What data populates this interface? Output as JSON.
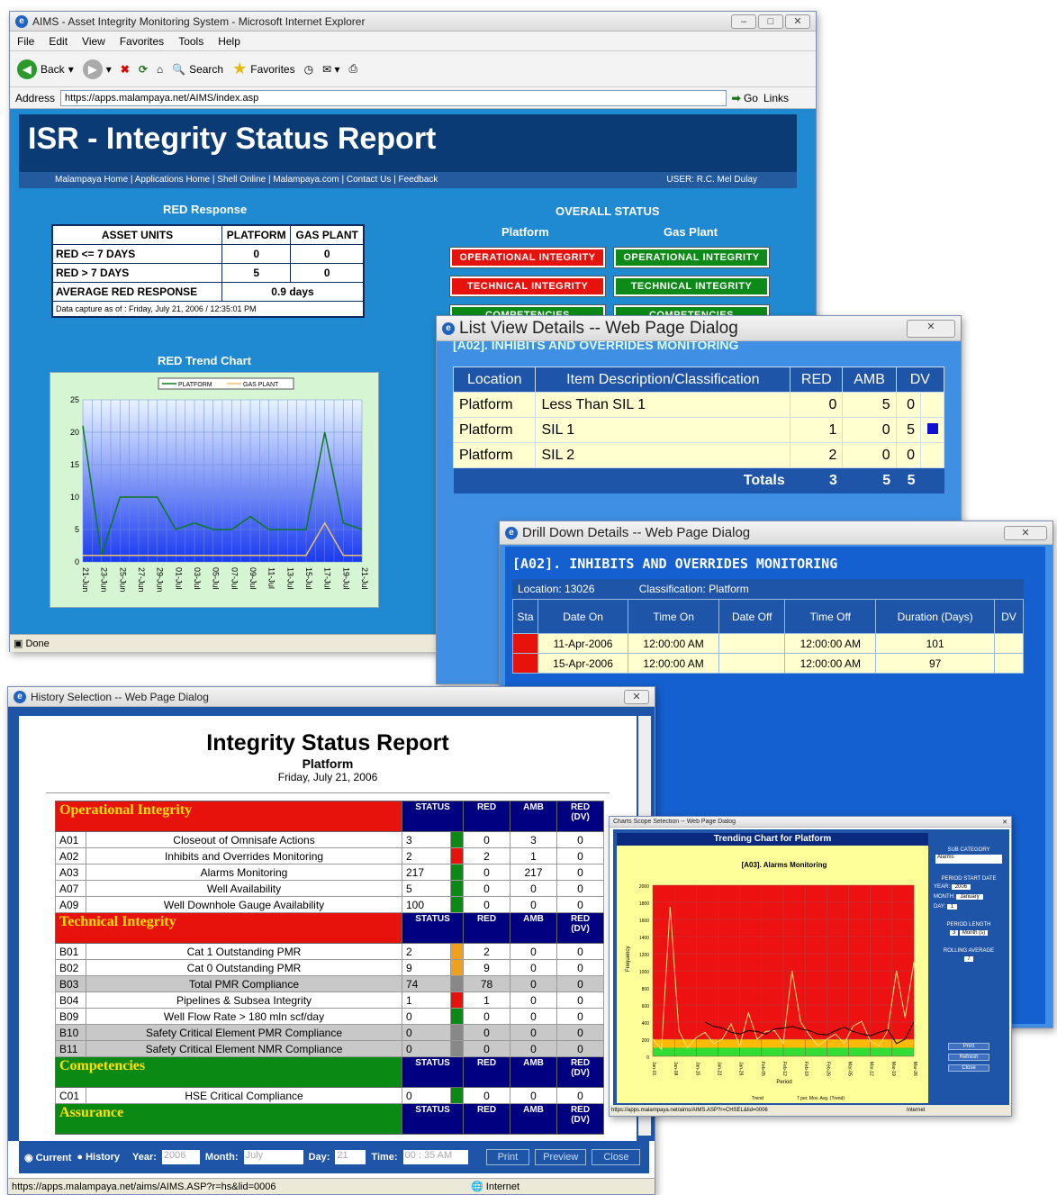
{
  "main": {
    "title": "AIMS - Asset Integrity Monitoring System - Microsoft Internet Explorer",
    "menu": [
      "File",
      "Edit",
      "View",
      "Favorites",
      "Tools",
      "Help"
    ],
    "toolbar": {
      "back": "Back",
      "search": "Search",
      "favorites": "Favorites"
    },
    "address_label": "Address",
    "address": "https://apps.malampaya.net/AIMS/index.asp",
    "go": "Go",
    "links": "Links",
    "banner": "ISR - Integrity Status Report",
    "nav": "Malampaya Home | Applications Home | Shell Online | Malampaya.com | Contact Us | Feedback",
    "user": "USER: R.C. Mel Dulay",
    "red_response_title": "RED Response",
    "red_table": {
      "headers": [
        "ASSET UNITS",
        "PLATFORM",
        "GAS PLANT"
      ],
      "rows": [
        [
          "RED <= 7 DAYS",
          "0",
          "0"
        ],
        [
          "RED > 7 DAYS",
          "5",
          "0"
        ]
      ],
      "avg_label": "AVERAGE RED RESPONSE",
      "avg_value": "0.9 days",
      "capture": "Data capture as of :  Friday, July 21, 2006 / 12:35:01 PM"
    },
    "overall_status": "OVERALL STATUS",
    "col_platform": "Platform",
    "col_gasplant": "Gas Plant",
    "status_pills": [
      [
        "OPERATIONAL INTEGRITY",
        "#e8120c",
        "OPERATIONAL INTEGRITY",
        "#0d8a17"
      ],
      [
        "TECHNICAL INTEGRITY",
        "#e8120c",
        "TECHNICAL INTEGRITY",
        "#0d8a17"
      ],
      [
        "COMPETENCIES",
        "#0d8a17",
        "COMPETENCIES",
        "#0d8a17"
      ]
    ],
    "trend_title": "RED Trend Chart",
    "status": "Done"
  },
  "chart_data": [
    {
      "type": "line",
      "title": "RED Trend Chart",
      "ylim": [
        0,
        25
      ],
      "categories": [
        "21-Jun",
        "23-Jun",
        "25-Jun",
        "27-Jun",
        "29-Jun",
        "01-Jul",
        "03-Jul",
        "05-Jul",
        "07-Jul",
        "09-Jul",
        "11-Jul",
        "13-Jul",
        "15-Jul",
        "17-Jul",
        "19-Jul",
        "21-Jul"
      ],
      "series": [
        {
          "name": "PLATFORM",
          "color": "#0a7a1c",
          "values": [
            21,
            1,
            10,
            10,
            10,
            5,
            6,
            5,
            5,
            7,
            5,
            5,
            5,
            20,
            6,
            5
          ]
        },
        {
          "name": "GAS PLANT",
          "color": "#f0c070",
          "values": [
            1,
            1,
            1,
            1,
            1,
            1,
            1,
            1,
            1,
            1,
            1,
            1,
            1,
            6,
            1,
            1
          ]
        }
      ]
    },
    {
      "type": "line",
      "title": "[A03]. Alarms Monitoring",
      "ylabel": "Frequency",
      "xlabel": "Period",
      "ylim": [
        0,
        2000
      ],
      "categories": [
        "Jan-01",
        "Jan-08",
        "Jan-15",
        "Jan-22",
        "Jan-29",
        "Feb-05",
        "Feb-12",
        "Feb-19",
        "Feb-26",
        "Mar-05",
        "Mar-12",
        "Mar-19",
        "Mar-26"
      ],
      "series": [
        {
          "name": "Trend",
          "color": "#ffe080",
          "values": [
            200,
            80,
            1750,
            300,
            100,
            220,
            280,
            150,
            200,
            380,
            120,
            510,
            200,
            290,
            300,
            150,
            1000,
            400,
            250,
            120,
            200,
            260,
            150,
            350,
            410,
            180,
            120,
            300,
            1000,
            450,
            1100
          ]
        },
        {
          "name": "7 per. Mov. Avg. (Trend)",
          "color": "#000000",
          "values": [
            null,
            null,
            null,
            null,
            null,
            null,
            400,
            350,
            330,
            280,
            260,
            300,
            290,
            260,
            320,
            330,
            350,
            320,
            300,
            260,
            250,
            300,
            340,
            290,
            260,
            240,
            280,
            310,
            150,
            200,
            400
          ]
        }
      ]
    }
  ],
  "listview": {
    "title": "List View Details -- Web Page Dialog",
    "heading": "[A02]. INHIBITS AND OVERRIDES MONITORING",
    "headers": [
      "Location",
      "Item Description/Classification",
      "RED",
      "AMB",
      "DV"
    ],
    "rows": [
      [
        "Platform",
        "Less Than SIL 1",
        "0",
        "5",
        "0"
      ],
      [
        "Platform",
        "SIL 1",
        "1",
        "0",
        "5"
      ],
      [
        "Platform",
        "SIL 2",
        "2",
        "0",
        "0"
      ]
    ],
    "totals_label": "Totals",
    "totals": [
      "3",
      "5",
      "5"
    ]
  },
  "drill": {
    "title": "Drill Down Details -- Web Page Dialog",
    "heading": "[A02]. INHIBITS AND OVERRIDES MONITORING",
    "location": "Location: 13026",
    "classification": "Classification: Platform",
    "headers": [
      "Sta",
      "Date On",
      "Time On",
      "Date Off",
      "Time Off",
      "Duration (Days)",
      "DV"
    ],
    "rows": [
      [
        "11-Apr-2006",
        "12:00:00 AM",
        "",
        "12:00:00 AM",
        "101"
      ],
      [
        "15-Apr-2006",
        "12:00:00 AM",
        "",
        "12:00:00 AM",
        "97"
      ]
    ]
  },
  "history": {
    "title": "History Selection -- Web Page Dialog",
    "report_title": "Integrity Status Report",
    "sub": "Platform",
    "date": "Friday, July 21, 2006",
    "col_heads": [
      "STATUS",
      "RED",
      "AMB",
      "RED (DV)"
    ],
    "sections": [
      {
        "name": "Operational Integrity",
        "color": "#e8120c",
        "rows": [
          [
            "A01",
            "Closeout of Omnisafe Actions",
            "3",
            "#0a8a14",
            "0",
            "3",
            "0"
          ],
          [
            "A02",
            "Inhibits and Overrides Monitoring",
            "2",
            "#e8120c",
            "2",
            "1",
            "0"
          ],
          [
            "A03",
            "Alarms Monitoring",
            "217",
            "#0a8a14",
            "0",
            "217",
            "0"
          ],
          [
            "A07",
            "Well Availability",
            "5",
            "#0a8a14",
            "0",
            "0",
            "0"
          ],
          [
            "A09",
            "Well Downhole Gauge Availability",
            "100",
            "#0a8a14",
            "0",
            "0",
            "0"
          ]
        ]
      },
      {
        "name": "Technical Integrity",
        "color": "#e8120c",
        "rows": [
          [
            "B01",
            "Cat 1 Outstanding PMR",
            "2",
            "#f0a020",
            "2",
            "0",
            "0"
          ],
          [
            "B02",
            "Cat 0 Outstanding PMR",
            "9",
            "#f0a020",
            "9",
            "0",
            "0"
          ],
          [
            "B03",
            "Total PMR Compliance",
            "74",
            "#888888",
            "78",
            "0",
            "0"
          ],
          [
            "B04",
            "Pipelines & Subsea Integrity",
            "1",
            "#e8120c",
            "1",
            "0",
            "0"
          ],
          [
            "B09",
            "Well Flow Rate > 180 mln scf/day",
            "0",
            "#0a8a14",
            "0",
            "0",
            "0"
          ],
          [
            "B10",
            "Safety Critical Element PMR Compliance",
            "0",
            "#888888",
            "0",
            "0",
            "0"
          ],
          [
            "B11",
            "Safety Critical Element NMR Compliance",
            "0",
            "#888888",
            "0",
            "0",
            "0"
          ]
        ]
      },
      {
        "name": "Competencies",
        "color": "#0a8a14",
        "rows": [
          [
            "C01",
            "HSE Critical Compliance",
            "0",
            "#0a8a14",
            "0",
            "0",
            "0"
          ]
        ]
      },
      {
        "name": "Assurance",
        "color": "#0a8a14",
        "rows": []
      }
    ],
    "controls": {
      "current": "Current",
      "history": "History",
      "year_label": "Year:",
      "year": "2006",
      "month_label": "Month:",
      "month": "July",
      "day_label": "Day:",
      "day": "21",
      "time_label": "Time:",
      "time": "00 : 35 AM",
      "print": "Print",
      "preview": "Preview",
      "close": "Close"
    },
    "status_url": "https://apps.malampaya.net/aims/AIMS.ASP?r=hs&lid=0006",
    "zone": "Internet"
  },
  "charts_dlg": {
    "title": "Charts Scope Selection -- Web Page Dialog",
    "heading": "Trending Chart for Platform",
    "subcat_label": "SUB CATEGORY",
    "subcat": "Alarms",
    "period_label": "PERIOD START DATE",
    "year_label": "YEAR:",
    "year": "2006",
    "month_label": "MONTH:",
    "month": "January",
    "day_label": "DAY:",
    "day": "1",
    "length_label": "PERIOD LENGTH",
    "length_n": "3",
    "length_unit": "Month (s)",
    "rolling_label": "ROLLING AVERAGE",
    "rolling": "7",
    "print": "Print",
    "refresh": "Refresh",
    "close": "Close",
    "status_url": "https://apps.malampaya.net/aims/AIMS.ASP?r=CHSEL&lid=0006",
    "zone": "Internet"
  }
}
